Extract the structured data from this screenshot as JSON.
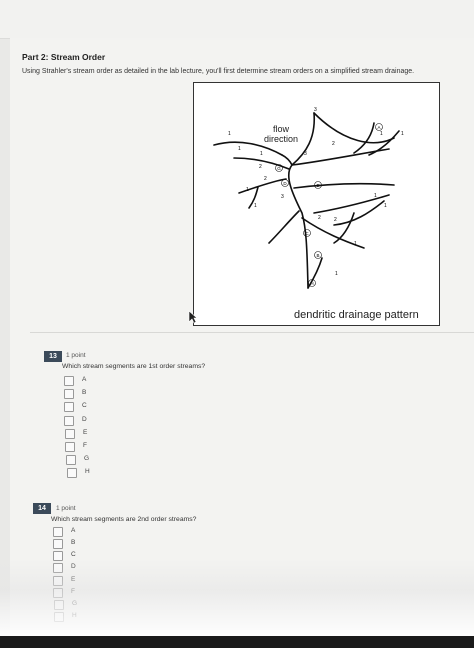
{
  "section": {
    "title": "Part 2: Stream Order",
    "instructions": "Using Strahler's stream order as detailed in the lab lecture, you'll first determine stream orders on a simplified stream drainage."
  },
  "figure": {
    "flow_label_line1": "flow",
    "flow_label_line2": "direction",
    "caption": "dendritic drainage pattern",
    "segment_letters": [
      "A",
      "B",
      "C",
      "D",
      "E",
      "F",
      "G",
      "H"
    ],
    "order_labels": [
      "1",
      "1",
      "1",
      "2",
      "2",
      "3",
      "1",
      "1",
      "2",
      "2",
      "1",
      "1",
      "1",
      "1",
      "3",
      "2",
      "3",
      "1",
      "1"
    ]
  },
  "questions": [
    {
      "number": "13",
      "points": "1 point",
      "text": "Which stream segments are 1st order streams?",
      "options": [
        "A",
        "B",
        "C",
        "D",
        "E",
        "F",
        "G",
        "H"
      ]
    },
    {
      "number": "14",
      "points": "1 point",
      "text": "Which stream segments are 2nd order streams?",
      "options": [
        "A",
        "B",
        "C",
        "D",
        "E",
        "F",
        "G",
        "H"
      ]
    }
  ]
}
